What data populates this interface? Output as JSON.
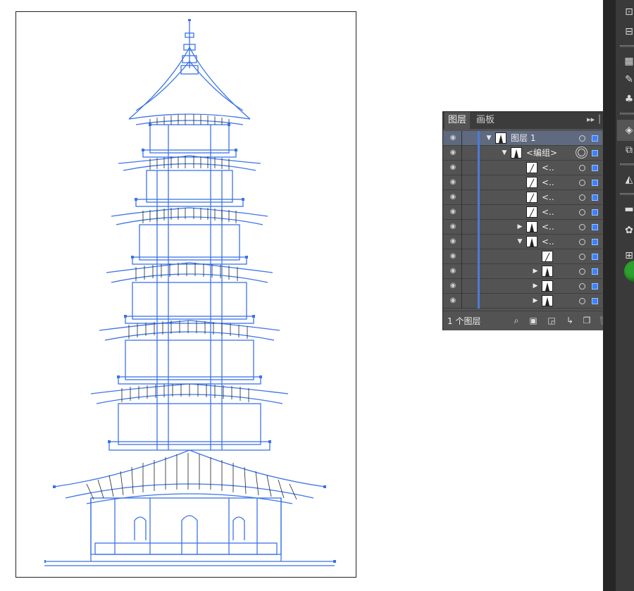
{
  "panel": {
    "tabs": [
      {
        "label": "图层",
        "active": true
      },
      {
        "label": "画板",
        "active": false
      }
    ],
    "menu_icon": "panel-menu-icon",
    "layers": [
      {
        "name": "图层 1",
        "indent": 0,
        "expanded": true,
        "thumb": "pagoda",
        "target": "ring",
        "selected": true
      },
      {
        "name": "<编组>",
        "indent": 1,
        "expanded": true,
        "thumb": "pagoda",
        "target": "double-ring",
        "selected": true
      },
      {
        "name": "<..",
        "indent": 2,
        "expanded": null,
        "thumb": "line",
        "target": "ring",
        "selected": true
      },
      {
        "name": "<..",
        "indent": 2,
        "expanded": null,
        "thumb": "line",
        "target": "ring",
        "selected": true
      },
      {
        "name": "<..",
        "indent": 2,
        "expanded": null,
        "thumb": "line",
        "target": "ring",
        "selected": true
      },
      {
        "name": "<..",
        "indent": 2,
        "expanded": null,
        "thumb": "line",
        "target": "ring",
        "selected": true
      },
      {
        "name": "<..",
        "indent": 2,
        "expanded": false,
        "thumb": "pagoda",
        "target": "ring",
        "selected": true
      },
      {
        "name": "<..",
        "indent": 2,
        "expanded": true,
        "thumb": "pagoda",
        "target": "ring",
        "selected": true
      },
      {
        "name": "",
        "indent": 3,
        "expanded": null,
        "thumb": "line",
        "target": "ring",
        "selected": true
      },
      {
        "name": "",
        "indent": 3,
        "expanded": false,
        "thumb": "pagoda",
        "target": "ring",
        "selected": true
      },
      {
        "name": "",
        "indent": 3,
        "expanded": false,
        "thumb": "pagoda",
        "target": "ring",
        "selected": true
      },
      {
        "name": "",
        "indent": 3,
        "expanded": false,
        "thumb": "pagoda",
        "target": "ring",
        "selected": true
      }
    ],
    "footer": {
      "count_label": "1 个图层",
      "icons": [
        "search-icon",
        "locate-object-icon",
        "make-clipping-mask-icon",
        "new-sublayer-icon",
        "new-layer-icon",
        "trash-icon"
      ]
    }
  },
  "colors": {
    "path_blue": "#3b73e8",
    "selection_blue": "#3b82f6",
    "panel_bg": "#535353",
    "panel_dark": "#3c3c3c",
    "dock_bg": "#3a3a3a"
  },
  "dock": {
    "icons": [
      "transform-icon",
      "align-icon",
      "swatches-icon",
      "brushes-icon",
      "symbols-icon",
      "layers-icon",
      "artboards-icon",
      "gradient-icon",
      "transparency-icon",
      "color-guide-icon",
      "appearance-icon"
    ]
  }
}
